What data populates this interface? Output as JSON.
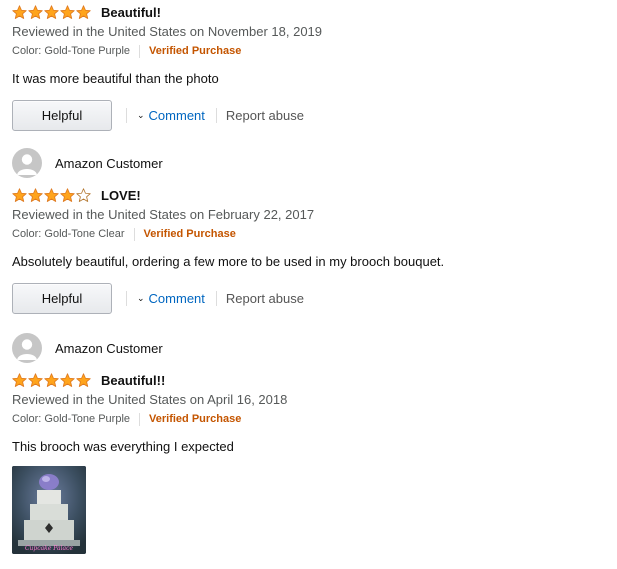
{
  "colors": {
    "star": "#ffa41c",
    "verified": "#c45500",
    "link": "#0066c0",
    "muted": "#565959"
  },
  "reviews": [
    {
      "title": "Beautiful!",
      "rating": 5,
      "date": "Reviewed in the United States on November 18, 2019",
      "color": "Color: Gold-Tone Purple",
      "verified": "Verified Purchase",
      "body": "It was more beautiful than the photo",
      "helpful": "Helpful",
      "comment": "Comment",
      "report": "Report abuse"
    },
    {
      "profile_name": "Amazon Customer",
      "title": "LOVE!",
      "rating": 4,
      "date": "Reviewed in the United States on February 22, 2017",
      "color": "Color: Gold-Tone Clear",
      "verified": "Verified Purchase",
      "body": "Absolutely beautiful, ordering a few more to be used in my brooch bouquet.",
      "helpful": "Helpful",
      "comment": "Comment",
      "report": "Report abuse"
    },
    {
      "profile_name": "Amazon Customer",
      "title": "Beautiful!!",
      "rating": 5,
      "date": "Reviewed in the United States on April 16, 2018",
      "color": "Color: Gold-Tone Purple",
      "verified": "Verified Purchase",
      "body": "This brooch was everything I expected",
      "photo_watermark": "Cupcake Palace"
    }
  ]
}
